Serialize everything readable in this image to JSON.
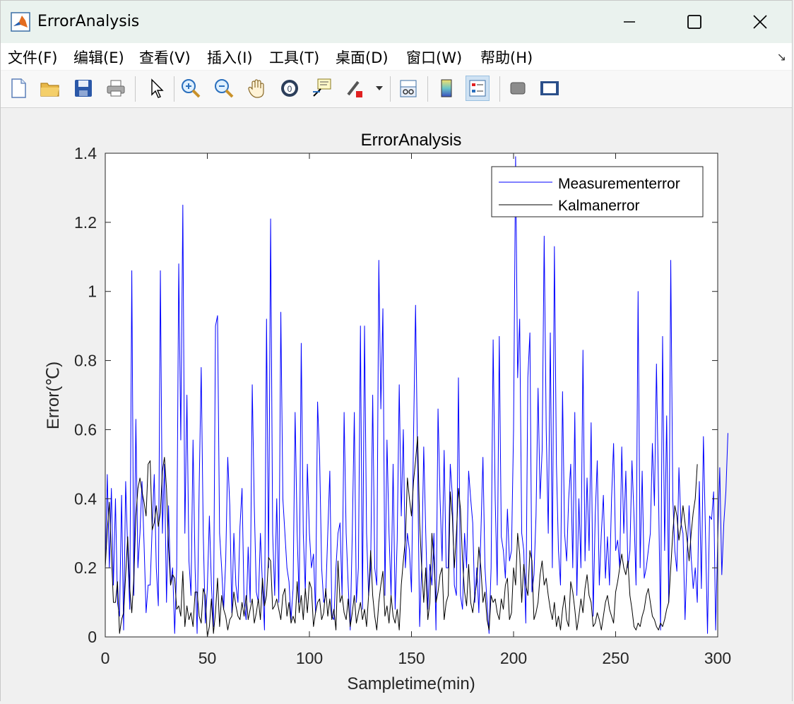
{
  "window": {
    "title": "ErrorAnalysis"
  },
  "menu": {
    "items": [
      "文件(F)",
      "编辑(E)",
      "查看(V)",
      "插入(I)",
      "工具(T)",
      "桌面(D)",
      "窗口(W)",
      "帮助(H)"
    ]
  },
  "toolbar": {
    "icons": [
      "new-figure",
      "open-file",
      "save",
      "print",
      "edit-plot-pointer",
      "zoom-in",
      "zoom-out",
      "pan",
      "rotate-3d",
      "data-cursor",
      "brush",
      "link-plot",
      "insert-colorbar",
      "insert-legend",
      "hide-plot-tools",
      "show-plot-tools"
    ]
  },
  "colors": {
    "measurement": "#0000ff",
    "kalman": "#000000",
    "axes_bg": "#ffffff",
    "figure_bg": "#f0f0f0"
  },
  "chart_data": {
    "type": "line",
    "title": "ErrorAnalysis",
    "xlabel": "Sampletime(min)",
    "ylabel": "Error(℃)",
    "xlim": [
      0,
      300
    ],
    "ylim": [
      0,
      1.4
    ],
    "xticks": [
      0,
      50,
      100,
      150,
      200,
      250,
      300
    ],
    "yticks": [
      0,
      0.2,
      0.4,
      0.6,
      0.8,
      1,
      1.2,
      1.4
    ],
    "ytick_labels": [
      "0",
      "0.2",
      "0.4",
      "0.6",
      "0.8",
      "1",
      "1.2",
      "1.4"
    ],
    "legend_position": "top-right",
    "grid": false,
    "series": [
      {
        "name": "Measurementerror",
        "color": "#0000ff",
        "x_start": 0,
        "x_step": 1,
        "values": [
          0.2,
          0.47,
          0.2,
          0.43,
          0.15,
          0.4,
          0.1,
          0.06,
          0.41,
          0.02,
          0.45,
          0.25,
          0.08,
          1.06,
          0.12,
          0.63,
          0.2,
          0.3,
          0.45,
          0.27,
          0.07,
          0.15,
          0.15,
          0.32,
          0.47,
          0.2,
          0.09,
          1.06,
          0.3,
          0.5,
          0.1,
          0.38,
          0.15,
          0.2,
          0.01,
          0.2,
          1.08,
          0.57,
          1.25,
          0.3,
          0.7,
          0.22,
          0.12,
          0.57,
          0.2,
          0.01,
          0.43,
          0.78,
          0.3,
          0.04,
          0.14,
          0.35,
          0.15,
          0.03,
          0.9,
          0.93,
          0.3,
          0.2,
          0.08,
          0.22,
          0.52,
          0.38,
          0.07,
          0.3,
          0.15,
          0.1,
          0.32,
          0.43,
          0.1,
          0.05,
          0.26,
          0.1,
          0.73,
          0.38,
          0.13,
          0.1,
          0.3,
          0.15,
          0.02,
          0.92,
          0.2,
          1.21,
          0.3,
          0.12,
          0.4,
          0.1,
          0.94,
          0.4,
          0.3,
          0.2,
          0.16,
          0.05,
          0.14,
          0.65,
          0.3,
          0.1,
          0.85,
          0.3,
          0.13,
          0.5,
          0.3,
          0.2,
          0.24,
          0.07,
          0.68,
          0.52,
          0.2,
          0.1,
          0.12,
          0.3,
          0.48,
          0.06,
          0.05,
          0.2,
          0.3,
          0.33,
          0.12,
          0.65,
          0.3,
          0.15,
          0.02,
          0.3,
          0.65,
          0.1,
          0.2,
          0.9,
          0.08,
          0.9,
          0.3,
          0.12,
          0.2,
          0.7,
          0.2,
          0.15,
          1.09,
          0.66,
          0.95,
          0.12,
          0.57,
          0.3,
          0.12,
          0.5,
          0.08,
          0.28,
          0.73,
          0.35,
          0.6,
          0.2,
          0.3,
          0.25,
          0.13,
          0.58,
          0.96,
          0.5,
          0.03,
          0.2,
          0.55,
          0.3,
          0.08,
          0.21,
          0.15,
          0.3,
          0.02,
          0.66,
          0.4,
          0.22,
          0.54,
          0.2,
          0.2,
          0.5,
          0.41,
          0.15,
          0.12,
          0.75,
          0.12,
          0.08,
          0.3,
          0.2,
          0.48,
          0.4,
          0.33,
          0.1,
          0.2,
          0.07,
          0.3,
          0.52,
          0.2,
          0.1,
          0.01,
          0.2,
          0.86,
          0.4,
          0.15,
          0.87,
          0.29,
          0.25,
          0.17,
          0.37,
          0.22,
          0.25,
          0.6,
          1.39,
          0.75,
          0.92,
          0.3,
          0.25,
          0.04,
          0.75,
          0.88,
          0.13,
          0.18,
          0.35,
          0.72,
          0.4,
          0.54,
          1.16,
          0.6,
          0.3,
          0.88,
          0.2,
          1.13,
          0.5,
          0.25,
          0.15,
          0.71,
          0.3,
          0.22,
          0.4,
          0.5,
          0.2,
          0.65,
          0.12,
          0.4,
          0.2,
          0.83,
          0.22,
          0.46,
          0.25,
          0.62,
          0.06,
          0.35,
          0.51,
          0.15,
          0.3,
          0.41,
          0.17,
          0.29,
          0.15,
          0.4,
          0.56,
          0.25,
          0.28,
          0.2,
          0.55,
          0.3,
          0.48,
          0.2,
          0.25,
          0.51,
          0.35,
          0.15,
          1.0,
          0.2,
          0.48,
          0.17,
          0.2,
          0.25,
          0.3,
          0.56,
          0.38,
          0.79,
          0.42,
          0.02,
          0.87,
          0.25,
          0.64,
          0.1,
          1.09,
          0.4,
          0.25,
          0.19,
          0.49,
          0.33,
          0.3,
          0.05,
          0.24,
          0.38,
          0.23,
          0.14,
          0.2,
          0.1,
          0.45,
          0.14,
          0.58,
          0.3,
          0.01,
          0.35,
          0.34,
          0.42,
          0.02,
          0.28,
          0.49,
          0.18,
          0.33,
          0.42,
          0.59
        ]
      },
      {
        "name": "Kalmanerror",
        "color": "#000000",
        "x_start": 0,
        "x_step": 1,
        "values": [
          0.2,
          0.31,
          0.39,
          0.24,
          0.1,
          0.1,
          0.16,
          0.01,
          0.05,
          0.07,
          0.18,
          0.29,
          0.14,
          0.07,
          0.17,
          0.35,
          0.43,
          0.46,
          0.42,
          0.39,
          0.35,
          0.5,
          0.51,
          0.31,
          0.33,
          0.38,
          0.32,
          0.36,
          0.48,
          0.52,
          0.43,
          0.26,
          0.15,
          0.18,
          0.17,
          0.08,
          0.09,
          0.06,
          0.19,
          0.03,
          0.09,
          0.05,
          0.07,
          0.03,
          0.13,
          0.13,
          0.06,
          0.04,
          0.14,
          0.12,
          0.0,
          0.03,
          0.11,
          0.01,
          0.07,
          0.17,
          0.03,
          0.12,
          0.08,
          0.06,
          0.02,
          0.05,
          0.06,
          0.13,
          0.09,
          0.06,
          0.05,
          0.1,
          0.06,
          0.12,
          0.05,
          0.08,
          0.11,
          0.04,
          0.07,
          0.11,
          0.05,
          0.17,
          0.09,
          0.12,
          0.23,
          0.22,
          0.08,
          0.09,
          0.11,
          0.08,
          0.05,
          0.12,
          0.14,
          0.06,
          0.1,
          0.04,
          0.06,
          0.04,
          0.16,
          0.07,
          0.12,
          0.05,
          0.14,
          0.07,
          0.16,
          0.14,
          0.03,
          0.07,
          0.1,
          0.11,
          0.05,
          0.07,
          0.14,
          0.06,
          0.11,
          0.05,
          0.08,
          0.02,
          0.22,
          0.1,
          0.12,
          0.07,
          0.05,
          0.11,
          0.03,
          0.07,
          0.12,
          0.04,
          0.07,
          0.1,
          0.05,
          0.08,
          0.03,
          0.12,
          0.25,
          0.12,
          0.06,
          0.02,
          0.1,
          0.15,
          0.19,
          0.06,
          0.09,
          0.04,
          0.12,
          0.06,
          0.04,
          0.08,
          0.02,
          0.15,
          0.22,
          0.28,
          0.46,
          0.4,
          0.35,
          0.45,
          0.51,
          0.58,
          0.33,
          0.2,
          0.1,
          0.2,
          0.05,
          0.1,
          0.3,
          0.22,
          0.1,
          0.13,
          0.18,
          0.2,
          0.05,
          0.1,
          0.12,
          0.42,
          0.35,
          0.2,
          0.3,
          0.43,
          0.37,
          0.22,
          0.13,
          0.09,
          0.21,
          0.1,
          0.07,
          0.12,
          0.16,
          0.26,
          0.2,
          0.1,
          0.13,
          0.05,
          0.02,
          0.12,
          0.1,
          0.11,
          0.07,
          0.05,
          0.11,
          0.08,
          0.15,
          0.17,
          0.05,
          0.07,
          0.2,
          0.15,
          0.3,
          0.24,
          0.1,
          0.21,
          0.15,
          0.12,
          0.25,
          0.22,
          0.05,
          0.07,
          0.1,
          0.18,
          0.22,
          0.15,
          0.17,
          0.12,
          0.08,
          0.05,
          0.1,
          0.03,
          0.06,
          0.02,
          0.08,
          0.12,
          0.05,
          0.03,
          0.16,
          0.13,
          0.08,
          0.02,
          0.06,
          0.11,
          0.07,
          0.14,
          0.18,
          0.12,
          0.1,
          0.03,
          0.04,
          0.07,
          0.05,
          0.02,
          0.06,
          0.1,
          0.12,
          0.08,
          0.06,
          0.04,
          0.13,
          0.16,
          0.2,
          0.24,
          0.2,
          0.18,
          0.22,
          0.12,
          0.08,
          0.03,
          0.02,
          0.04,
          0.03,
          0.06,
          0.08,
          0.12,
          0.14,
          0.1,
          0.06,
          0.05,
          0.03,
          0.02,
          0.04,
          0.03,
          0.05,
          0.08,
          0.1,
          0.2,
          0.3,
          0.38,
          0.35,
          0.28,
          0.32,
          0.38,
          0.33,
          0.28,
          0.22,
          0.3,
          0.36,
          0.4,
          0.5
        ]
      }
    ]
  }
}
